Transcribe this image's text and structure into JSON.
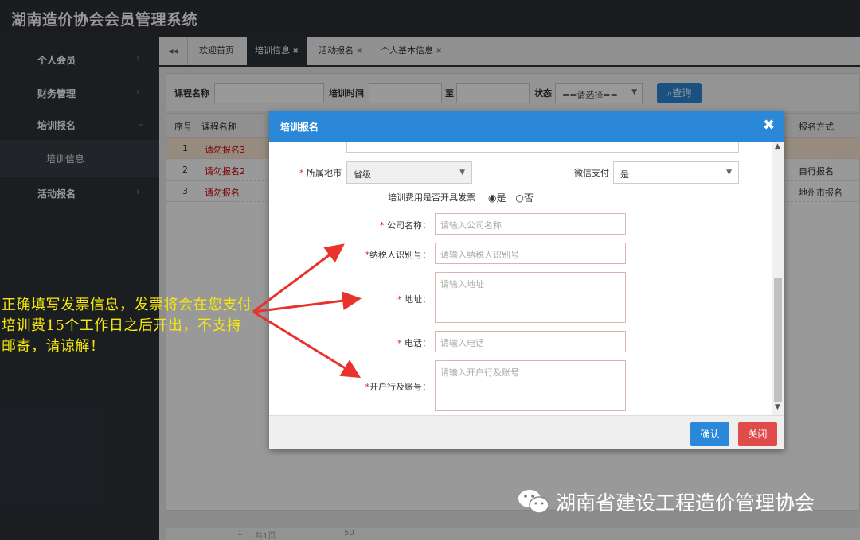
{
  "app": {
    "title": "湖南造价协会会员管理系统"
  },
  "sidebar": {
    "items": [
      {
        "label": "个人会员",
        "chevron": "›"
      },
      {
        "label": "财务管理",
        "chevron": "›"
      },
      {
        "label": "培训报名",
        "chevron": "⌄"
      },
      {
        "label": "活动报名",
        "chevron": "›"
      }
    ],
    "sub_item": "培训信息"
  },
  "tabs": {
    "back_icon": "double-left-arrow-icon",
    "back_glyph": "◂◂",
    "items": [
      {
        "label": "欢迎首页",
        "closable": false
      },
      {
        "label": "培训信息",
        "closable": true
      },
      {
        "label": "活动报名",
        "closable": true
      },
      {
        "label": "个人基本信息",
        "closable": true
      }
    ],
    "close_glyph": "✖"
  },
  "filter": {
    "course_name_label": "课程名称",
    "time_label": "培训时间",
    "to_label": "至",
    "status_label": "状态",
    "status_value": "==请选择==",
    "query_button": "查询",
    "query_icon": "search-icon"
  },
  "grid": {
    "columns": [
      "序号",
      "课程名称",
      "报名方式"
    ],
    "rows": [
      {
        "index": "1",
        "name": "请勿报名3",
        "method": ""
      },
      {
        "index": "2",
        "name": "请勿报名2",
        "method": "自行报名"
      },
      {
        "index": "3",
        "name": "请勿报名",
        "method": "地州市报名"
      }
    ]
  },
  "pager": {
    "page_value": "1",
    "page_total": "共1页",
    "page_size": "50"
  },
  "modal": {
    "title": "培训报名",
    "close_glyph": "✖",
    "city_label": "所属地市",
    "city_value": "省级",
    "wechat_label": "微信支付",
    "wechat_value": "是",
    "invoice_question": "培训费用是否开具发票",
    "invoice_yes": "是",
    "invoice_no": "否",
    "company_label": "公司名称：",
    "company_placeholder": "请输入公司名称",
    "tax_label": "纳税人识别号：",
    "tax_placeholder": "请输入纳税人识别号",
    "address_label": "地址：",
    "address_placeholder": "请输入地址",
    "phone_label": "电话：",
    "phone_placeholder": "请输入电话",
    "bank_label": "开户行及账号：",
    "bank_placeholder": "请输入开户行及账号",
    "required_mark": "*",
    "confirm_button": "确认",
    "close_button": "关闭"
  },
  "annotation": {
    "text": "正确填写发票信息，发票将会在您支付培训费15个工作日之后开出，不支持邮寄，请谅解！",
    "color": "#f6e80e",
    "arrow_color": "#e8322b"
  },
  "watermark": {
    "text": "湖南省建设工程造价管理协会",
    "icon": "wechat-icon"
  }
}
